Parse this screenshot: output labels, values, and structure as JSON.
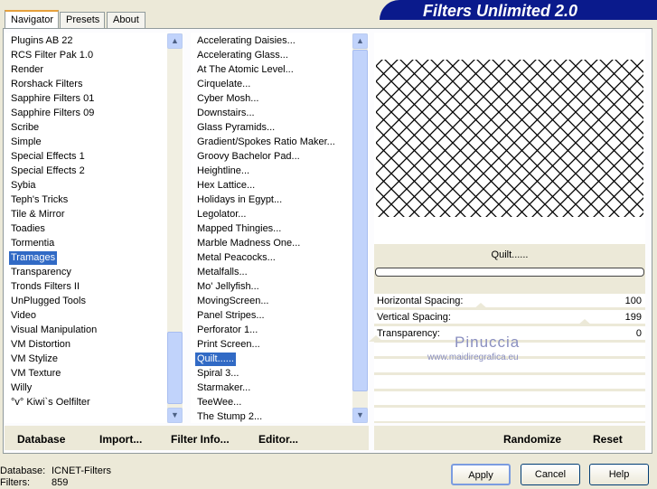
{
  "banner": {
    "title": "Filters Unlimited 2.0"
  },
  "tabs": [
    {
      "label": "Navigator",
      "active": true
    },
    {
      "label": "Presets"
    },
    {
      "label": "About"
    }
  ],
  "categories": {
    "items": [
      "Plugins AB 22",
      "RCS Filter Pak 1.0",
      "Render",
      "Rorshack Filters",
      "Sapphire Filters 01",
      "Sapphire Filters 09",
      "Scribe",
      "Simple",
      "Special Effects 1",
      "Special Effects 2",
      "Sybia",
      "Teph's Tricks",
      "Tile & Mirror",
      "Toadies",
      "Tormentia",
      "Tramages",
      "Transparency",
      "Tronds Filters II",
      "UnPlugged Tools",
      "Video",
      "Visual Manipulation",
      "VM Distortion",
      "VM Stylize",
      "VM Texture",
      "Willy",
      "°v° Kiwi`s Oelfilter"
    ],
    "selected": "Tramages"
  },
  "filters": {
    "items": [
      "Accelerating Daisies...",
      "Accelerating Glass...",
      "At The Atomic Level...",
      "Cirquelate...",
      "Cyber Mosh...",
      "Downstairs...",
      "Glass Pyramids...",
      "Gradient/Spokes Ratio Maker...",
      "Groovy Bachelor Pad...",
      "Heightline...",
      "Hex Lattice...",
      "Holidays in Egypt...",
      "Legolator...",
      "Mapped Thingies...",
      "Marble Madness One...",
      "Metal Peacocks...",
      "Metalfalls...",
      "Mo' Jellyfish...",
      "MovingScreen...",
      "Panel Stripes...",
      "Perforator 1...",
      "Print Screen...",
      "Quilt......",
      "Spiral 3...",
      "Starmaker...",
      "TeeWee...",
      "The Stump 2..."
    ],
    "selected": "Quilt......"
  },
  "preview": {
    "filter_name": "Quilt......",
    "progress": 0
  },
  "params": [
    {
      "label": "Horizontal Spacing:",
      "value": "100",
      "level": 100
    },
    {
      "label": "Vertical Spacing:",
      "value": "199",
      "level": 199
    },
    {
      "label": "Transparency:",
      "value": "0",
      "level": 0
    }
  ],
  "watermark": {
    "name": "Pinuccia",
    "url": "www.maidiregrafica.eu"
  },
  "buttons": {
    "database": "Database",
    "import": "Import...",
    "filter_info": "Filter Info...",
    "editor": "Editor...",
    "randomize": "Randomize",
    "reset": "Reset",
    "apply": "Apply",
    "cancel": "Cancel",
    "help": "Help"
  },
  "status": {
    "database_label": "Database:",
    "database_value": "ICNET-Filters",
    "filters_label": "Filters:",
    "filters_value": "859"
  }
}
